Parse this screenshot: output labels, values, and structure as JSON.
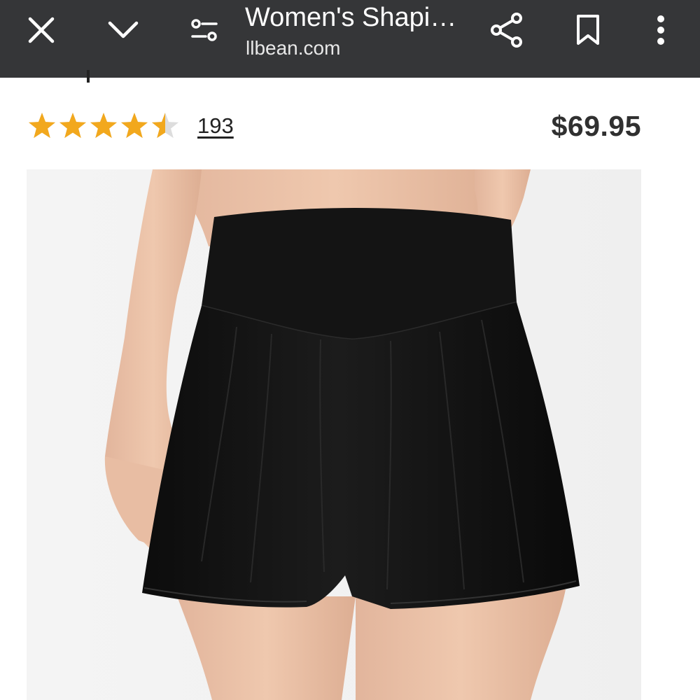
{
  "browser_bar": {
    "title": "Women's Shapin…",
    "domain": "llbean.com",
    "icons": [
      "close-icon",
      "chevron-down-icon",
      "page-settings-icon",
      "share-icon",
      "bookmark-icon",
      "more-vert-icon"
    ]
  },
  "product": {
    "rating": 4.5,
    "rating_max": 5,
    "review_count": "193",
    "price": "$69.95",
    "image_subject": "black high-waisted swim shorts on model"
  },
  "colors": {
    "topbar_bg": "#353638",
    "star_fill": "#f2a81d",
    "star_empty": "#dddddd",
    "price_text": "#303030"
  }
}
